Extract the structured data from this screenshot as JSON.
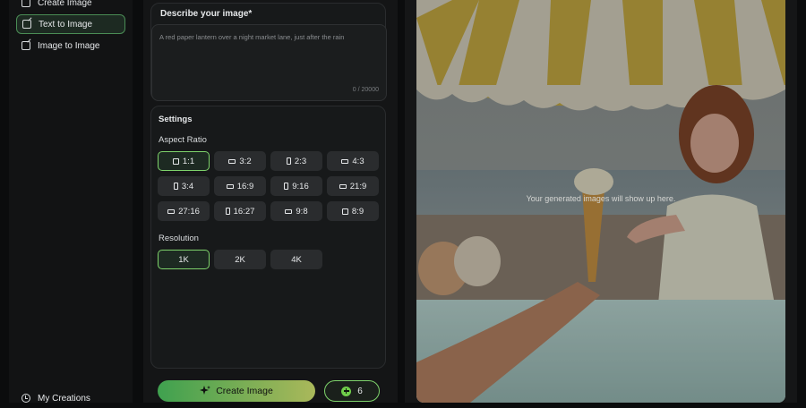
{
  "sidebar": {
    "items": [
      {
        "label": "Create Image",
        "icon": "image-edit-icon"
      },
      {
        "label": "Text to Image",
        "icon": "text-edit-icon",
        "active": true
      },
      {
        "label": "Image to Image",
        "icon": "image-edit-icon"
      },
      {
        "label": "My Creations",
        "icon": "clock-icon"
      }
    ]
  },
  "prompt": {
    "title": "Describe your image*",
    "placeholder": "A red paper lantern over a night market lane, just after the rain",
    "counter": "0 / 20000"
  },
  "settings": {
    "title": "Settings",
    "aspect_label": "Aspect Ratio",
    "aspect_options": [
      "1:1",
      "3:2",
      "2:3",
      "4:3",
      "3:4",
      "16:9",
      "9:16",
      "21:9",
      "27:16",
      "16:27",
      "9:8",
      "8:9"
    ],
    "aspect_selected": "1:1",
    "resolution_label": "Resolution",
    "resolution_options": [
      "1K",
      "2K",
      "4K"
    ],
    "resolution_selected": "1K"
  },
  "actions": {
    "create_label": "Create Image",
    "credits": "6"
  },
  "preview": {
    "empty_text": "Your generated images will show up here."
  },
  "colors": {
    "accent": "#7ed36b",
    "gradient_start": "#3fa14f",
    "gradient_end": "#aab85a"
  }
}
